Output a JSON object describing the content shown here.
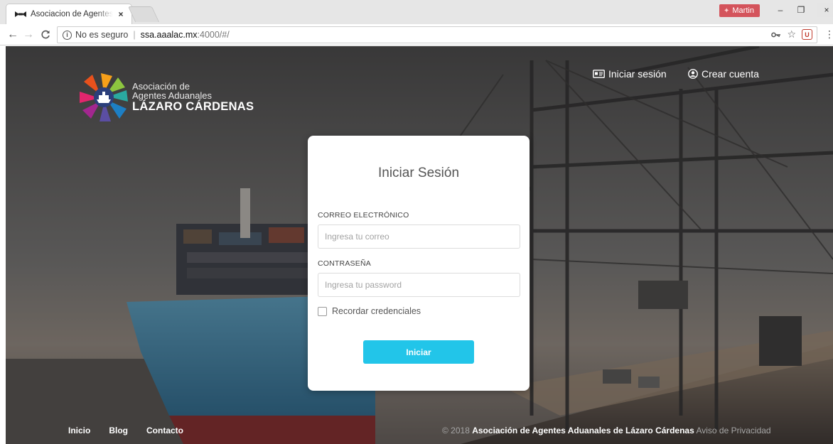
{
  "browser": {
    "tab_title": "Asociacion de Agentes Aduanales",
    "tab_close": "×",
    "profile_name": "Martin",
    "window_min": "–",
    "window_max": "❐",
    "window_close": "×",
    "back": "←",
    "forward": "→",
    "reload": "C",
    "security_label": "No es seguro",
    "url_host": "ssa.aaalac.mx",
    "url_rest": ":4000/#/",
    "menu": "⋮"
  },
  "header": {
    "logo_line1": "Asociación de",
    "logo_line2": "Agentes Aduanales",
    "logo_line3": "LÁZARO CÁRDENAS",
    "login_link": "Iniciar sesión",
    "signup_link": "Crear cuenta"
  },
  "login_form": {
    "title": "Iniciar Sesión",
    "email_label": "CORREO ELECTRÓNICO",
    "email_placeholder": "Ingresa tu correo",
    "email_value": "",
    "password_label": "CONTRASEÑA",
    "password_placeholder": "Ingresa tu password",
    "password_value": "",
    "remember_label": "Recordar credenciales",
    "remember_checked": false,
    "submit_label": "Iniciar",
    "submit_color": "#22c5e9"
  },
  "footer": {
    "links": [
      "Inicio",
      "Blog",
      "Contacto"
    ],
    "copyright_prefix": "© 2018 ",
    "copyright_org": "Asociación de Agentes Aduanales de Lázaro Cárdenas",
    "privacy_link": " Aviso de Privacidad"
  },
  "icons": {
    "login": "id-card-icon",
    "signup": "user-circle-icon",
    "key": "key-icon",
    "star": "bookmark-star-icon",
    "extension": "extension-icon"
  }
}
